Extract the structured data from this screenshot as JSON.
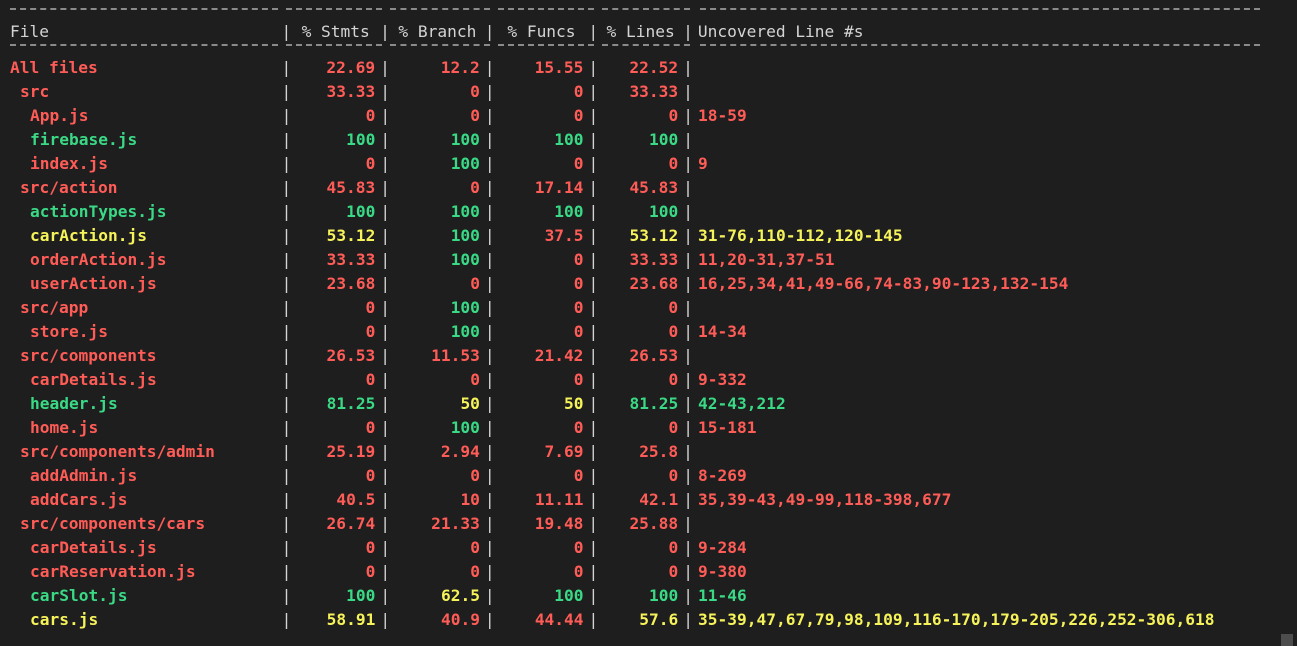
{
  "header": {
    "file": "File",
    "stmts": "% Stmts",
    "branch": "% Branch",
    "funcs": "% Funcs",
    "lines": "% Lines",
    "uncovered": "Uncovered Line #s"
  },
  "colors": {
    "low": "#ff5c57",
    "medium": "#f6f35a",
    "high": "#3ad985",
    "background": "#1e1e1e"
  },
  "rows": [
    {
      "file": "All files",
      "indent": 0,
      "color": "red",
      "stmts": "22.69",
      "branch": "12.2",
      "funcs": "15.55",
      "lines": "22.52",
      "uncovered": "",
      "cell_colors": [
        "red",
        "red",
        "red",
        "red"
      ]
    },
    {
      "file": "src",
      "indent": 1,
      "color": "red",
      "stmts": "33.33",
      "branch": "0",
      "funcs": "0",
      "lines": "33.33",
      "uncovered": "",
      "cell_colors": [
        "red",
        "red",
        "red",
        "red"
      ]
    },
    {
      "file": "App.js",
      "indent": 2,
      "color": "red",
      "stmts": "0",
      "branch": "0",
      "funcs": "0",
      "lines": "0",
      "uncovered": "18-59",
      "cell_colors": [
        "red",
        "red",
        "red",
        "red"
      ]
    },
    {
      "file": "firebase.js",
      "indent": 2,
      "color": "green",
      "stmts": "100",
      "branch": "100",
      "funcs": "100",
      "lines": "100",
      "uncovered": "",
      "cell_colors": [
        "green",
        "green",
        "green",
        "green"
      ]
    },
    {
      "file": "index.js",
      "indent": 2,
      "color": "red",
      "stmts": "0",
      "branch": "100",
      "funcs": "0",
      "lines": "0",
      "uncovered": "9",
      "cell_colors": [
        "red",
        "green",
        "red",
        "red"
      ]
    },
    {
      "file": "src/action",
      "indent": 1,
      "color": "red",
      "stmts": "45.83",
      "branch": "0",
      "funcs": "17.14",
      "lines": "45.83",
      "uncovered": "",
      "cell_colors": [
        "red",
        "red",
        "red",
        "red"
      ]
    },
    {
      "file": "actionTypes.js",
      "indent": 2,
      "color": "green",
      "stmts": "100",
      "branch": "100",
      "funcs": "100",
      "lines": "100",
      "uncovered": "",
      "cell_colors": [
        "green",
        "green",
        "green",
        "green"
      ]
    },
    {
      "file": "carAction.js",
      "indent": 2,
      "color": "yellow",
      "stmts": "53.12",
      "branch": "100",
      "funcs": "37.5",
      "lines": "53.12",
      "uncovered": "31-76,110-112,120-145",
      "cell_colors": [
        "yellow",
        "green",
        "red",
        "yellow"
      ]
    },
    {
      "file": "orderAction.js",
      "indent": 2,
      "color": "red",
      "stmts": "33.33",
      "branch": "100",
      "funcs": "0",
      "lines": "33.33",
      "uncovered": "11,20-31,37-51",
      "cell_colors": [
        "red",
        "green",
        "red",
        "red"
      ]
    },
    {
      "file": "userAction.js",
      "indent": 2,
      "color": "red",
      "stmts": "23.68",
      "branch": "0",
      "funcs": "0",
      "lines": "23.68",
      "uncovered": "16,25,34,41,49-66,74-83,90-123,132-154",
      "cell_colors": [
        "red",
        "red",
        "red",
        "red"
      ]
    },
    {
      "file": "src/app",
      "indent": 1,
      "color": "red",
      "stmts": "0",
      "branch": "100",
      "funcs": "0",
      "lines": "0",
      "uncovered": "",
      "cell_colors": [
        "red",
        "green",
        "red",
        "red"
      ]
    },
    {
      "file": "store.js",
      "indent": 2,
      "color": "red",
      "stmts": "0",
      "branch": "100",
      "funcs": "0",
      "lines": "0",
      "uncovered": "14-34",
      "cell_colors": [
        "red",
        "green",
        "red",
        "red"
      ]
    },
    {
      "file": "src/components",
      "indent": 1,
      "color": "red",
      "stmts": "26.53",
      "branch": "11.53",
      "funcs": "21.42",
      "lines": "26.53",
      "uncovered": "",
      "cell_colors": [
        "red",
        "red",
        "red",
        "red"
      ]
    },
    {
      "file": "carDetails.js",
      "indent": 2,
      "color": "red",
      "stmts": "0",
      "branch": "0",
      "funcs": "0",
      "lines": "0",
      "uncovered": "9-332",
      "cell_colors": [
        "red",
        "red",
        "red",
        "red"
      ]
    },
    {
      "file": "header.js",
      "indent": 2,
      "color": "green",
      "stmts": "81.25",
      "branch": "50",
      "funcs": "50",
      "lines": "81.25",
      "uncovered": "42-43,212",
      "cell_colors": [
        "green",
        "yellow",
        "yellow",
        "green"
      ]
    },
    {
      "file": "home.js",
      "indent": 2,
      "color": "red",
      "stmts": "0",
      "branch": "100",
      "funcs": "0",
      "lines": "0",
      "uncovered": "15-181",
      "cell_colors": [
        "red",
        "green",
        "red",
        "red"
      ]
    },
    {
      "file": "src/components/admin",
      "indent": 1,
      "color": "red",
      "stmts": "25.19",
      "branch": "2.94",
      "funcs": "7.69",
      "lines": "25.8",
      "uncovered": "",
      "cell_colors": [
        "red",
        "red",
        "red",
        "red"
      ]
    },
    {
      "file": "addAdmin.js",
      "indent": 2,
      "color": "red",
      "stmts": "0",
      "branch": "0",
      "funcs": "0",
      "lines": "0",
      "uncovered": "8-269",
      "cell_colors": [
        "red",
        "red",
        "red",
        "red"
      ]
    },
    {
      "file": "addCars.js",
      "indent": 2,
      "color": "red",
      "stmts": "40.5",
      "branch": "10",
      "funcs": "11.11",
      "lines": "42.1",
      "uncovered": "35,39-43,49-99,118-398,677",
      "cell_colors": [
        "red",
        "red",
        "red",
        "red"
      ]
    },
    {
      "file": "src/components/cars",
      "indent": 1,
      "color": "red",
      "stmts": "26.74",
      "branch": "21.33",
      "funcs": "19.48",
      "lines": "25.88",
      "uncovered": "",
      "cell_colors": [
        "red",
        "red",
        "red",
        "red"
      ]
    },
    {
      "file": "carDetails.js",
      "indent": 2,
      "color": "red",
      "stmts": "0",
      "branch": "0",
      "funcs": "0",
      "lines": "0",
      "uncovered": "9-284",
      "cell_colors": [
        "red",
        "red",
        "red",
        "red"
      ]
    },
    {
      "file": "carReservation.js",
      "indent": 2,
      "color": "red",
      "stmts": "0",
      "branch": "0",
      "funcs": "0",
      "lines": "0",
      "uncovered": "9-380",
      "cell_colors": [
        "red",
        "red",
        "red",
        "red"
      ]
    },
    {
      "file": "carSlot.js",
      "indent": 2,
      "color": "green",
      "stmts": "100",
      "branch": "62.5",
      "funcs": "100",
      "lines": "100",
      "uncovered": "11-46",
      "cell_colors": [
        "green",
        "yellow",
        "green",
        "green"
      ]
    },
    {
      "file": "cars.js",
      "indent": 2,
      "color": "yellow",
      "stmts": "58.91",
      "branch": "40.9",
      "funcs": "44.44",
      "lines": "57.6",
      "uncovered": "35-39,47,67,79,98,109,116-170,179-205,226,252-306,618",
      "cell_colors": [
        "yellow",
        "red",
        "red",
        "yellow"
      ]
    }
  ]
}
